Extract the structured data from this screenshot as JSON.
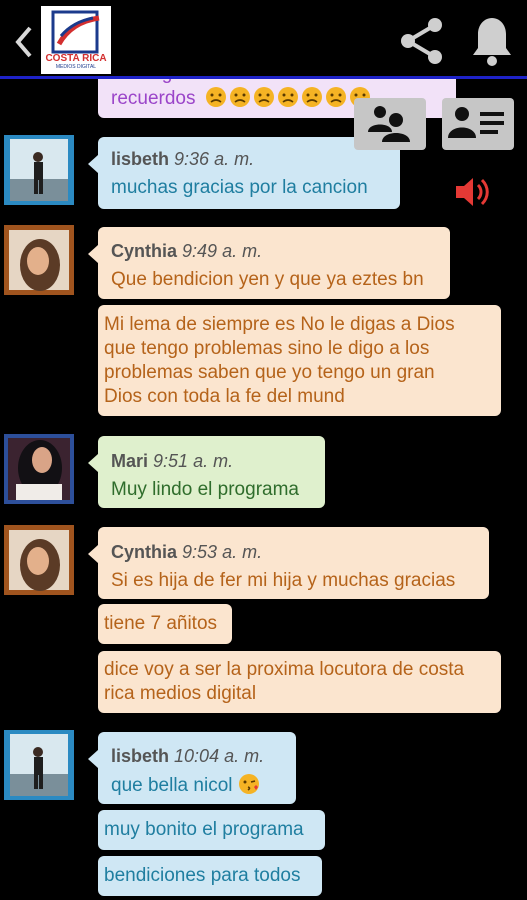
{
  "header": {
    "logo_title": "COSTA RICA",
    "logo_subtitle": "MEDIOS DIGITAL"
  },
  "messages": {
    "partial_line1": "nostalgia esta cancion de me vienen tantos",
    "partial_line2": "recuerdos",
    "m1": {
      "name": "lisbeth",
      "time": "9:36 a. m.",
      "text": "muchas gracias por la cancion"
    },
    "m2": {
      "name": "Cynthia",
      "time": "9:49 a. m.",
      "text": "Que bendicion yen y que ya eztes bn",
      "extra": [
        "Mi lema de siempre es No le digas a Dios",
        "que tengo problemas sino le digo a los",
        "problemas saben que yo tengo un gran",
        "Dios con toda la fe del mund"
      ]
    },
    "m3": {
      "name": "Mari",
      "time": "9:51 a. m.",
      "text": "Muy lindo el programa"
    },
    "m4": {
      "name": "Cynthia",
      "time": "9:53 a. m.",
      "text": "Si es hija de fer mi hija y muchas gracias",
      "extra1": "tiene 7 añitos",
      "extra2_l1": "dice voy a ser la proxima locutora de costa",
      "extra2_l2": "rica medios digital"
    },
    "m5": {
      "name": "lisbeth",
      "time": "10:04 a. m.",
      "text": "que bella nicol",
      "extra1": "muy bonito el programa",
      "extra2": "bendiciones para todos"
    }
  },
  "colors": {
    "blue_bubble": "#cfe7f4",
    "peach_bubble": "#fbe5cf",
    "green_bubble": "#dff0cd",
    "accent_line": "#1e22c8",
    "speaker": "#e53935"
  }
}
